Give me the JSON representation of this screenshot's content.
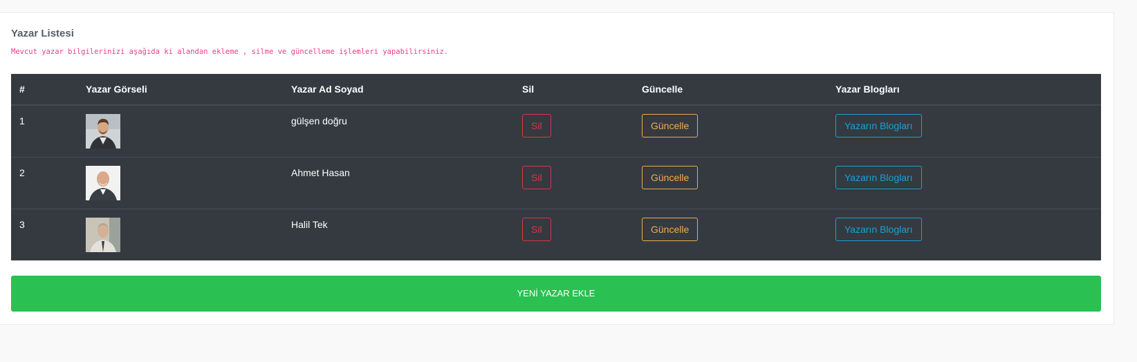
{
  "card": {
    "title": "Yazar Listesi",
    "description": "Mevcut yazar bilgilerinizi aşağıda ki alandan ekleme , silme ve güncelleme işlemleri yapabilirsiniz."
  },
  "table": {
    "headers": [
      "#",
      "Yazar Görseli",
      "Yazar Ad Soyad",
      "Sil",
      "Güncelle",
      "Yazar Blogları"
    ],
    "rows": [
      {
        "id": "1",
        "name": "gülşen doğru",
        "image": "author-photo-icon",
        "delete": "Sil",
        "update": "Güncelle",
        "blogs": "Yazarın Blogları"
      },
      {
        "id": "2",
        "name": "Ahmet Hasan",
        "image": "author-photo-icon",
        "delete": "Sil",
        "update": "Güncelle",
        "blogs": "Yazarın Blogları"
      },
      {
        "id": "3",
        "name": "Halil Tek",
        "image": "author-photo-icon",
        "delete": "Sil",
        "update": "Güncelle",
        "blogs": "Yazarın Blogları"
      }
    ]
  },
  "add_button": "YENİ YAZAR EKLE",
  "colors": {
    "table_bg": "#343a40",
    "danger": "#dc3545",
    "warning": "#f0ad4e",
    "info": "#17a2d8",
    "success": "#2ac052",
    "description": "#e83e8c"
  }
}
